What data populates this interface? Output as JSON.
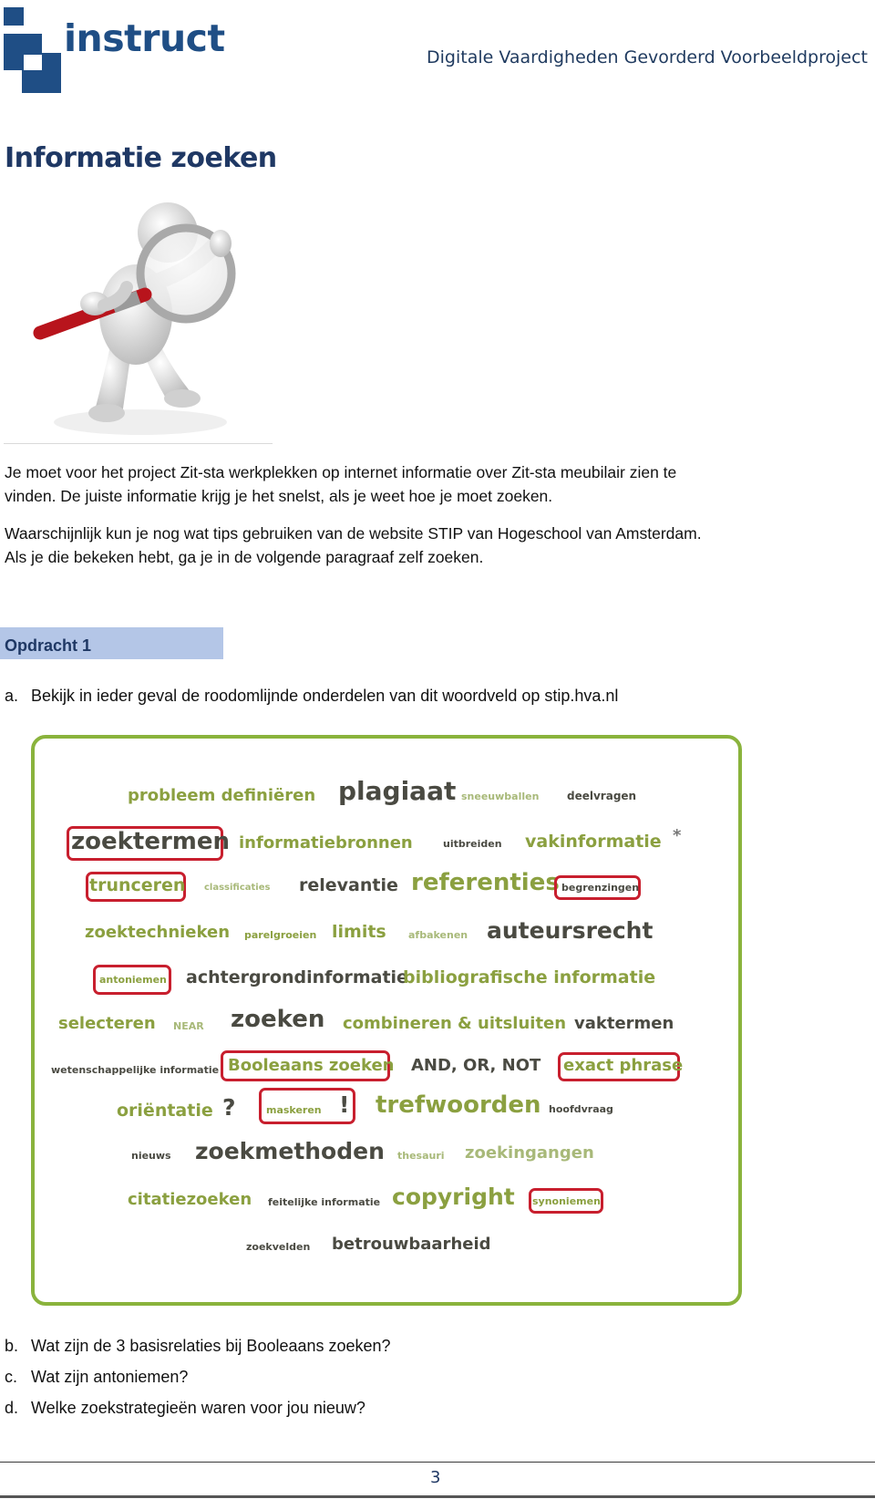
{
  "header": {
    "logo_text": "instruct",
    "title": "Digitale Vaardigheden Gevorderd Voorbeeldproject"
  },
  "page_title": "Informatie zoeken",
  "figure": {
    "description": "3D figure holding a magnifying glass",
    "icon": "magnifier-person-icon"
  },
  "paragraphs": [
    "Je moet voor het project Zit-sta werkplekken op internet informatie over Zit-sta meubilair zien te vinden. De juiste informatie krijg je het snelst, als je weet hoe je moet zoeken.",
    "Waarschijnlijk kun je nog wat tips gebruiken van de website STIP van Hogeschool van Amsterdam. Als je die bekeken hebt, ga je in de volgende paragraaf zelf zoeken."
  ],
  "paragraph_lines": [
    "Je moet voor het project Zit-sta werkplekken op internet informatie over Zit-sta meubilair zien te",
    "vinden. De juiste informatie krijg je het snelst, als je weet hoe je moet zoeken.",
    "Waarschijnlijk kun je nog wat tips gebruiken van de website STIP van Hogeschool van Amsterdam.",
    "Als je die bekeken hebt, ga je in de volgende paragraaf zelf zoeken."
  ],
  "assignment": {
    "heading": "Opdracht 1",
    "questions": [
      {
        "label": "a.",
        "text": "Bekijk in ieder geval de roodomlijnde onderdelen van dit woordveld op stip.hva.nl"
      },
      {
        "label": "b.",
        "text": "Wat zijn de 3 basisrelaties bij Booleaans zoeken?"
      },
      {
        "label": "c.",
        "text": "Wat zijn antoniemen?"
      },
      {
        "label": "d.",
        "text": "Welke zoekstrategieën waren voor jou nieuw?"
      }
    ]
  },
  "word_cloud": {
    "border_color": "#8ab33c",
    "highlight_color": "#c81f2e",
    "words": [
      {
        "text": "probleem definiëren",
        "highlighted": false
      },
      {
        "text": "plagiaat",
        "highlighted": false
      },
      {
        "text": "sneeuwballen",
        "highlighted": false
      },
      {
        "text": "deelvragen",
        "highlighted": false
      },
      {
        "text": "zoektermen",
        "highlighted": true
      },
      {
        "text": "informatiebronnen",
        "highlighted": false
      },
      {
        "text": "uitbreiden",
        "highlighted": false
      },
      {
        "text": "vakinformatie",
        "highlighted": false
      },
      {
        "text": "*",
        "highlighted": false
      },
      {
        "text": "trunceren",
        "highlighted": true
      },
      {
        "text": "classificaties",
        "highlighted": false
      },
      {
        "text": "relevantie",
        "highlighted": false
      },
      {
        "text": "referenties",
        "highlighted": false
      },
      {
        "text": "begrenzingen",
        "highlighted": true
      },
      {
        "text": "zoektechnieken",
        "highlighted": false
      },
      {
        "text": "parelgroeien",
        "highlighted": false
      },
      {
        "text": "limits",
        "highlighted": false
      },
      {
        "text": "afbakenen",
        "highlighted": false
      },
      {
        "text": "auteursrecht",
        "highlighted": false
      },
      {
        "text": "antoniemen",
        "highlighted": true
      },
      {
        "text": "achtergrondinformatie",
        "highlighted": false
      },
      {
        "text": "bibliografische informatie",
        "highlighted": false
      },
      {
        "text": "selecteren",
        "highlighted": false
      },
      {
        "text": "NEAR",
        "highlighted": false
      },
      {
        "text": "zoeken",
        "highlighted": false
      },
      {
        "text": "combineren & uitsluiten",
        "highlighted": false
      },
      {
        "text": "vaktermen",
        "highlighted": false
      },
      {
        "text": "wetenschappelijke informatie",
        "highlighted": false
      },
      {
        "text": "Booleaans zoeken",
        "highlighted": true
      },
      {
        "text": "AND, OR, NOT",
        "highlighted": false
      },
      {
        "text": "exact phrase",
        "highlighted": true
      },
      {
        "text": "oriëntatie",
        "highlighted": false
      },
      {
        "text": "?",
        "highlighted": false
      },
      {
        "text": "maskeren",
        "highlighted": true
      },
      {
        "text": "!",
        "highlighted": true
      },
      {
        "text": "trefwoorden",
        "highlighted": false
      },
      {
        "text": "hoofdvraag",
        "highlighted": false
      },
      {
        "text": "nieuws",
        "highlighted": false
      },
      {
        "text": "zoekmethoden",
        "highlighted": false
      },
      {
        "text": "thesauri",
        "highlighted": false
      },
      {
        "text": "zoekingangen",
        "highlighted": false
      },
      {
        "text": "citatiezoeken",
        "highlighted": false
      },
      {
        "text": "feitelijke informatie",
        "highlighted": false
      },
      {
        "text": "copyright",
        "highlighted": false
      },
      {
        "text": "synoniemen",
        "highlighted": true
      },
      {
        "text": "zoekvelden",
        "highlighted": false
      },
      {
        "text": "betrouwbaarheid",
        "highlighted": false
      }
    ]
  },
  "footer": {
    "page_number": "3"
  }
}
